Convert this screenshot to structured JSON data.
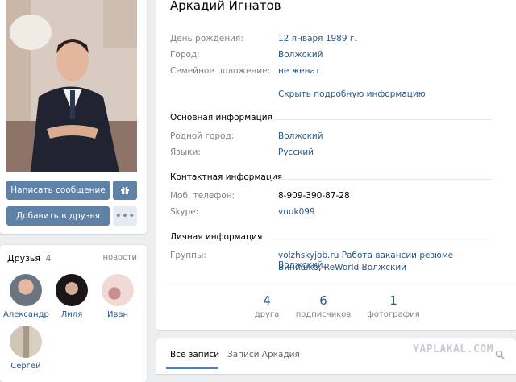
{
  "profile": {
    "name": "Аркадий Игнатов",
    "details": [
      {
        "label": "День рождения:",
        "value": "12 января 1989 г.",
        "is_link": true
      },
      {
        "label": "Город:",
        "value": "Волжский",
        "is_link": true
      },
      {
        "label": "Семейное положение:",
        "value": "не женат",
        "is_link": true
      }
    ],
    "toggle_link": "Скрыть подробную информацию",
    "sections": {
      "main": {
        "title": "Основная информация",
        "rows": [
          {
            "label": "Родной город:",
            "value": "Волжский"
          },
          {
            "label": "Языки:",
            "value": "Русский"
          }
        ]
      },
      "contacts": {
        "title": "Контактная информация",
        "rows": [
          {
            "label": "Моб. телефон:",
            "value": "8-909-390-87-28"
          },
          {
            "label": "Skype:",
            "value": "vnuk099"
          }
        ]
      },
      "personal": {
        "title": "Личная информация",
        "groups_label": "Группы:",
        "groups_line1": "volzhskyjob.ru Работа вакансии резюме Волжский,",
        "groups_line2_a": "Винишко",
        "groups_line2_sep": ", ",
        "groups_line2_b": "ReWorld Волжский"
      }
    },
    "counters": [
      {
        "num": "4",
        "caption": "друга"
      },
      {
        "num": "6",
        "caption": "подписчиков"
      },
      {
        "num": "1",
        "caption": "фотография"
      }
    ]
  },
  "actions": {
    "message": "Написать сообщение",
    "add_friend": "Добавить в друзья"
  },
  "friends": {
    "title": "Друзья",
    "count": "4",
    "news": "новости",
    "list": [
      {
        "name": "Александр"
      },
      {
        "name": "Лиля"
      },
      {
        "name": "Иван"
      },
      {
        "name": "Сергей"
      }
    ]
  },
  "wall": {
    "tab_all": "Все записи",
    "tab_owner": "Записи Аркадия"
  },
  "watermark": "YAPLAKAL.COM",
  "colors": {
    "accent": "#2a5885",
    "button": "#5e81a8",
    "background": "#edeef0"
  }
}
